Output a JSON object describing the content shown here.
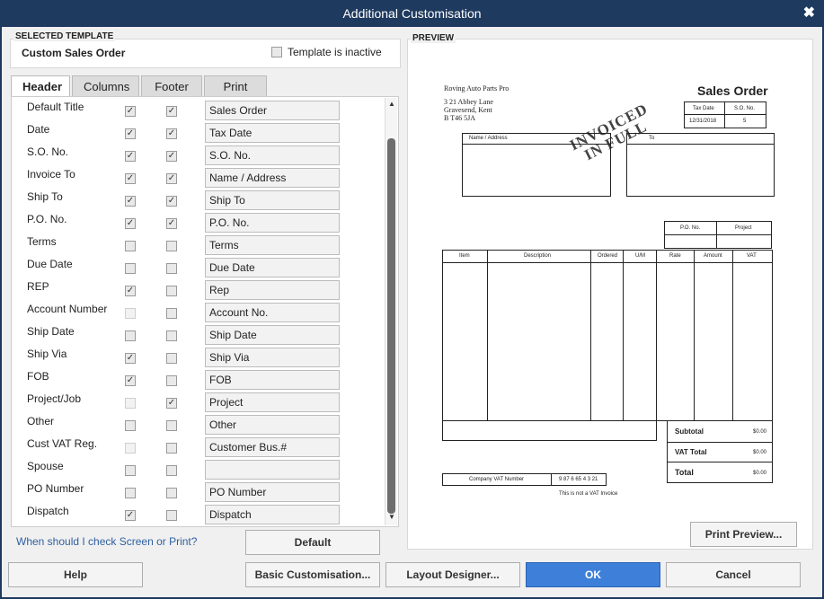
{
  "window": {
    "title": "Additional Customisation",
    "close_glyph": "✖"
  },
  "template": {
    "section_label": "SELECTED TEMPLATE",
    "name": "Custom Sales Order",
    "inactive_label": "Template is inactive",
    "inactive_checked": false
  },
  "tabs": [
    {
      "label": "Header",
      "active": true
    },
    {
      "label": "Columns",
      "active": false
    },
    {
      "label": "Footer",
      "active": false
    },
    {
      "label": "Print",
      "active": false
    }
  ],
  "fields": [
    {
      "label": "Default Title",
      "screen": true,
      "print": true,
      "title": "Sales Order",
      "screen_disabled": false
    },
    {
      "label": "Date",
      "screen": true,
      "print": true,
      "title": "Tax Date",
      "screen_disabled": false
    },
    {
      "label": "S.O. No.",
      "screen": true,
      "print": true,
      "title": "S.O. No.",
      "screen_disabled": false
    },
    {
      "label": "Invoice To",
      "screen": true,
      "print": true,
      "title": "Name / Address",
      "screen_disabled": false
    },
    {
      "label": "Ship To",
      "screen": true,
      "print": true,
      "title": "Ship To",
      "screen_disabled": false
    },
    {
      "label": "P.O. No.",
      "screen": true,
      "print": true,
      "title": "P.O. No.",
      "screen_disabled": false
    },
    {
      "label": "Terms",
      "screen": false,
      "print": false,
      "title": "Terms",
      "screen_disabled": false
    },
    {
      "label": "Due Date",
      "screen": false,
      "print": false,
      "title": "Due Date",
      "screen_disabled": false
    },
    {
      "label": "REP",
      "screen": true,
      "print": false,
      "title": "Rep",
      "screen_disabled": false
    },
    {
      "label": "Account Number",
      "screen": false,
      "print": false,
      "title": "Account No.",
      "screen_disabled": true
    },
    {
      "label": "Ship Date",
      "screen": false,
      "print": false,
      "title": "Ship Date",
      "screen_disabled": false
    },
    {
      "label": "Ship Via",
      "screen": true,
      "print": false,
      "title": "Ship Via",
      "screen_disabled": false
    },
    {
      "label": "FOB",
      "screen": true,
      "print": false,
      "title": "FOB",
      "screen_disabled": false
    },
    {
      "label": "Project/Job",
      "screen": false,
      "print": true,
      "title": "Project",
      "screen_disabled": true
    },
    {
      "label": "Other",
      "screen": false,
      "print": false,
      "title": "Other",
      "screen_disabled": false
    },
    {
      "label": "Cust VAT Reg.",
      "screen": false,
      "print": false,
      "title": "Customer Bus.#",
      "screen_disabled": true
    },
    {
      "label": "Spouse",
      "screen": false,
      "print": false,
      "title": "",
      "screen_disabled": false
    },
    {
      "label": "PO Number",
      "screen": false,
      "print": false,
      "title": "PO Number",
      "screen_disabled": false
    },
    {
      "label": "Dispatch",
      "screen": true,
      "print": false,
      "title": "Dispatch",
      "screen_disabled": false
    }
  ],
  "links": {
    "check_screen_print": "When should I check Screen or Print?"
  },
  "buttons": {
    "default": "Default",
    "help": "Help",
    "basic": "Basic Customisation...",
    "layout": "Layout Designer...",
    "ok": "OK",
    "cancel": "Cancel",
    "print_preview": "Print Preview..."
  },
  "preview": {
    "section_label": "PREVIEW",
    "company_name": "Roving Auto Parts Pro",
    "address_line1": "3 21 Abbey Lane",
    "address_line2": "Gravesend, Kent",
    "address_line3": "B T46 5JA",
    "doc_title": "Sales Order",
    "col_tax_date": "Tax Date",
    "col_so_no": "S.O. No.",
    "tax_date_value": "12/31/2018",
    "so_no_value": "5",
    "name_address": "Name / Address",
    "ship_to_partial": "To",
    "stamp_line1": "INVOICED",
    "stamp_line2": "IN FULL",
    "po_no": "P.O. No.",
    "project": "Project",
    "item_cols": [
      "Item",
      "Description",
      "Ordered",
      "U/M",
      "Rate",
      "Amount",
      "VAT"
    ],
    "subtotal_label": "Subtotal",
    "subtotal_value": "$0.00",
    "vat_total_label": "VAT Total",
    "vat_total_value": "$0.00",
    "total_label": "Total",
    "total_value": "$0.00",
    "company_vat_label": "Company VAT Number",
    "company_vat_value": "9 87 6 65 4 3 21",
    "footer_note": "This is not a VAT Invoice"
  }
}
